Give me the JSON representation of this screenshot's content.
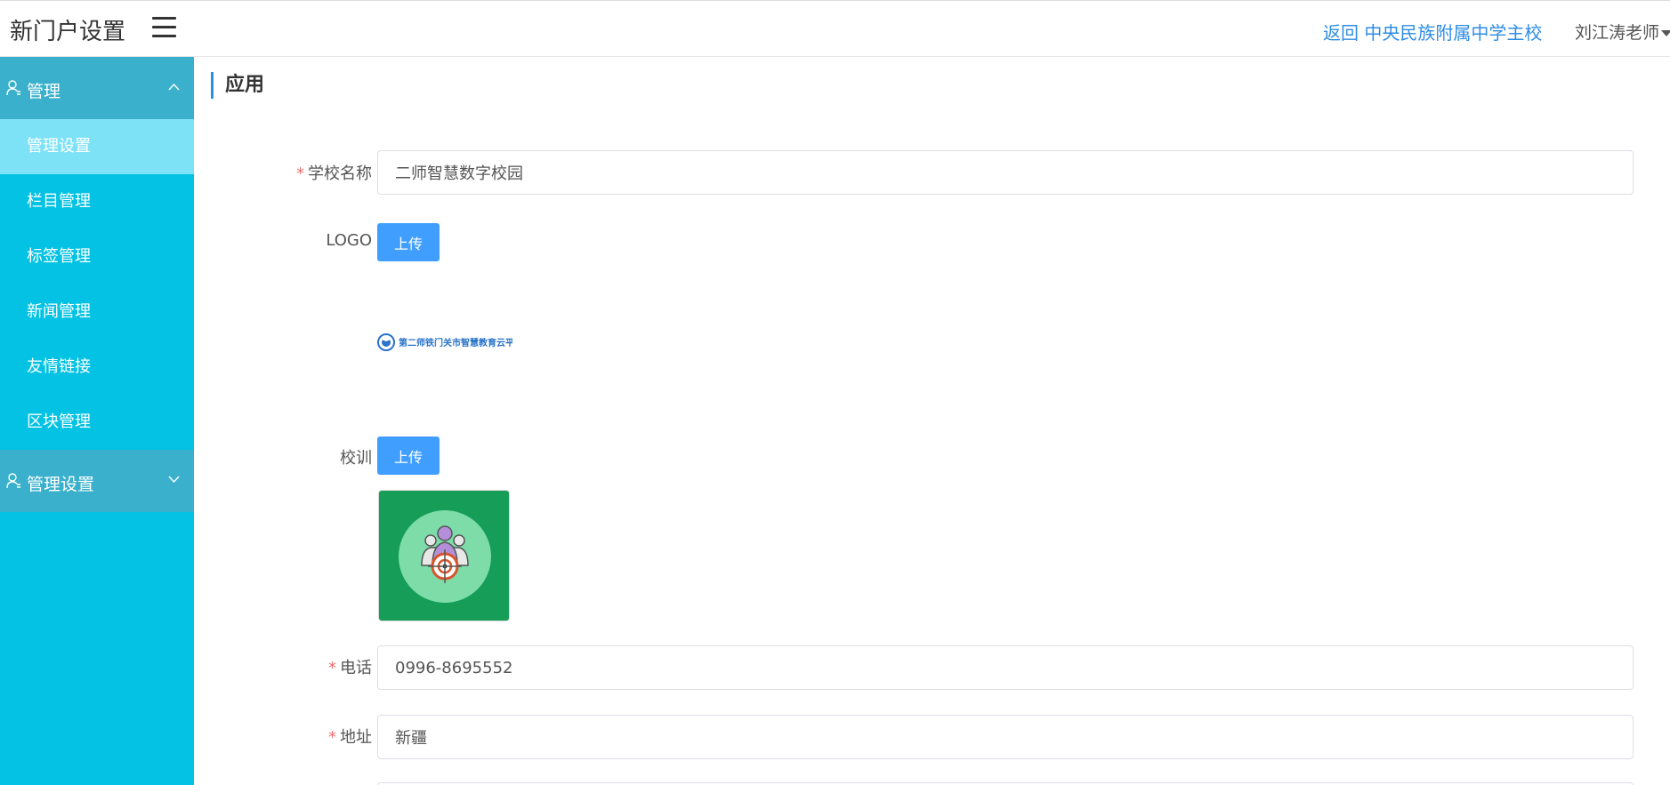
{
  "header": {
    "app_title": "新门户设置",
    "back_link": "返回 中央民族附属中学主校",
    "user_name": "刘江涛老师"
  },
  "sidebar": {
    "groups": [
      {
        "label": "管理",
        "expanded": true,
        "items": [
          {
            "label": "管理设置",
            "active": true
          },
          {
            "label": "栏目管理"
          },
          {
            "label": "标签管理"
          },
          {
            "label": "新闻管理"
          },
          {
            "label": "友情链接"
          },
          {
            "label": "区块管理"
          }
        ]
      },
      {
        "label": "管理设置",
        "expanded": false
      }
    ]
  },
  "main": {
    "section_title": "应用",
    "form": {
      "school_name": {
        "label": "学校名称",
        "required": "*",
        "value": "二师智慧数字校园"
      },
      "logo": {
        "label": "LOGO",
        "button": "上传",
        "preview_text": "第二师铁门关市智慧教育云平台"
      },
      "motto": {
        "label": "校训",
        "button": "上传"
      },
      "phone": {
        "label": "电话",
        "required": "*",
        "value": "0996-8695552"
      },
      "address": {
        "label": "地址",
        "required": "*",
        "value": "新疆"
      }
    }
  },
  "colors": {
    "sidebar_bg": "#03c2e3",
    "sidebar_group_bg": "#3ab0cc",
    "sidebar_active_bg": "#7ee2f6",
    "accent": "#409eff",
    "link": "#2f8de4",
    "required": "#f56c6c",
    "motto_bg": "#169e58"
  },
  "icons": {
    "menu_toggle": "hamburger-icon",
    "group": "user-icon",
    "expand": "chevron-up-icon",
    "collapse": "chevron-down-icon",
    "user_dropdown": "caret-down-icon"
  }
}
